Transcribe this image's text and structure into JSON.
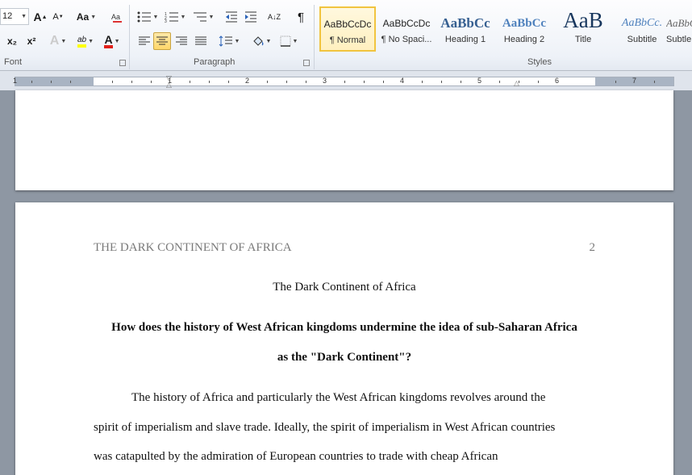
{
  "ribbon": {
    "font": {
      "size_value": "12",
      "grow_label": "A",
      "shrink_label": "A",
      "case_label": "Aa",
      "subscript_label": "x₂",
      "superscript_label": "x²",
      "highlight_label": "ab",
      "font_color_label": "A",
      "group_label": "Font"
    },
    "paragraph": {
      "sort_label": "A↓Z",
      "pilcrow_label": "¶",
      "group_label": "Paragraph"
    },
    "styles": {
      "group_label": "Styles",
      "items": [
        {
          "sample": "AaBbCcDc",
          "name": "¶ Normal"
        },
        {
          "sample": "AaBbCcDc",
          "name": "¶ No Spaci..."
        },
        {
          "sample": "AaBbCc",
          "name": "Heading 1"
        },
        {
          "sample": "AaBbCc",
          "name": "Heading 2"
        },
        {
          "sample": "AaB",
          "name": "Title"
        },
        {
          "sample": "AaBbCc.",
          "name": "Subtitle"
        },
        {
          "sample": "AaBbCc",
          "name": "Subtle"
        }
      ]
    }
  },
  "ruler": {
    "numbers": [
      "1",
      "1",
      "2",
      "3",
      "4",
      "5",
      "6",
      "7"
    ]
  },
  "document": {
    "running_head": "THE DARK CONTINENT OF AFRICA",
    "page_number": "2",
    "title": "The Dark Continent of Africa",
    "question_line1": "How does the history of West African kingdoms undermine the idea of sub-Saharan Africa",
    "question_line2": "as the \"Dark Continent\"?",
    "body_lines": [
      "The history of Africa and particularly the West African kingdoms revolves around the",
      "spirit of imperialism  and slave trade. Ideally, the spirit of imperialism  in West African countries",
      "was catapulted by the admiration of European countries to trade with cheap African"
    ]
  },
  "colors": {
    "highlight": "#ffff00",
    "font_color": "#e0201a",
    "heading_blue": "#365f91",
    "selected_style_border": "#f1c43f"
  }
}
